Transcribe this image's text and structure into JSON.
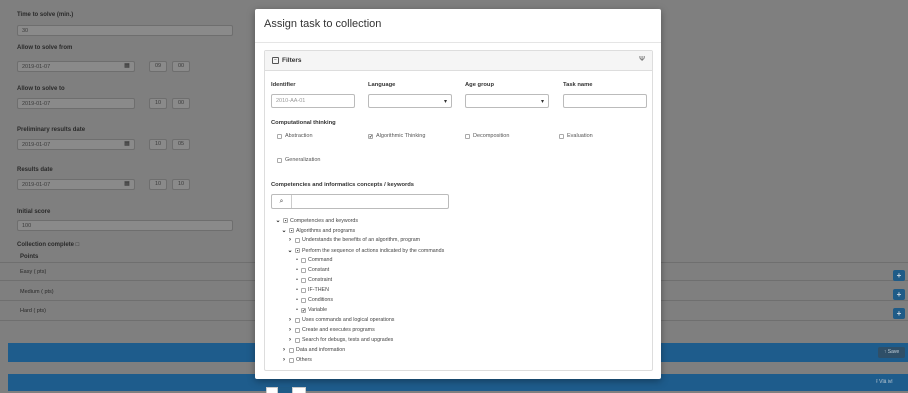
{
  "background": {
    "time_label": "Time to solve (min.)",
    "time_value": "30",
    "allow_from_label": "Allow to solve from",
    "allow_from_date": "2019-01-07",
    "allow_from_h": "09",
    "allow_from_m": "00",
    "allow_to_label": "Allow to solve to",
    "allow_to_date": "2019-01-07",
    "allow_to_h": "10",
    "allow_to_m": "00",
    "prelim_label": "Preliminary results date",
    "prelim_date": "2019-01-07",
    "prelim_h": "10",
    "prelim_m": "05",
    "results_label": "Results date",
    "results_date": "2019-01-07",
    "results_h": "10",
    "results_m": "10",
    "initial_score_label": "Initial score",
    "initial_score_value": "100",
    "collection_complete_label": "Collection complete □",
    "points_label": "Points",
    "easy_label": "Easy ( pts)",
    "medium_label": "Medium ( pts)",
    "hard_label": "Hard ( pts)",
    "plus": "+",
    "save_label": "↑ Save",
    "bottom_right_text": "⭱ Vlä ivl",
    "calendar_glyph": "▦"
  },
  "modal": {
    "title": "Assign task to collection",
    "filters_title": "Filters",
    "filter_icon_glyph": "Ψ",
    "identifier_label": "Identifier",
    "identifier_placeholder": "2010-AA-01",
    "language_label": "Language",
    "age_group_label": "Age group",
    "task_name_label": "Task name",
    "caret": "▾",
    "ct_label": "Computational thinking",
    "ct_options": [
      {
        "label": "Abstraction",
        "checked": false
      },
      {
        "label": "Algorithmic Thinking",
        "checked": true
      },
      {
        "label": "Decomposition",
        "checked": false
      },
      {
        "label": "Evaluation",
        "checked": false
      },
      {
        "label": "Generalization",
        "checked": false
      }
    ],
    "keywords_label": "Competencies and informatics concepts / keywords",
    "search_glyph": "⌕",
    "tree": [
      {
        "label": "Competencies and keywords",
        "level": 0,
        "expander": "✔",
        "checked": "partial"
      },
      {
        "label": "Algorithms and programs",
        "level": 1,
        "expander": "✔",
        "checked": "partial"
      },
      {
        "label": "Understands the benefits of an algorithm, program",
        "level": 2,
        "expander": "❯",
        "checked": "no"
      },
      {
        "label": "Perform the sequence of actions indicated by the commands",
        "level": 2,
        "expander": "✔",
        "checked": "partial"
      },
      {
        "label": "Command",
        "level": 3,
        "expander": "•",
        "checked": "no"
      },
      {
        "label": "Constant",
        "level": 3,
        "expander": "•",
        "checked": "no"
      },
      {
        "label": "Constraint",
        "level": 3,
        "expander": "•",
        "checked": "no"
      },
      {
        "label": "IF-THEN",
        "level": 3,
        "expander": "•",
        "checked": "no"
      },
      {
        "label": "Conditions",
        "level": 3,
        "expander": "•",
        "checked": "no"
      },
      {
        "label": "Variable",
        "level": 3,
        "expander": "•",
        "checked": "yes"
      },
      {
        "label": "Uses commands and logical operations",
        "level": 2,
        "expander": "❯",
        "checked": "no"
      },
      {
        "label": "Create and executes programs",
        "level": 2,
        "expander": "❯",
        "checked": "no"
      },
      {
        "label": "Search for debugs, tests and upgrades",
        "level": 2,
        "expander": "❯",
        "checked": "no"
      },
      {
        "label": "Data and information",
        "level": 1,
        "expander": "❯",
        "checked": "no"
      },
      {
        "label": "Others",
        "level": 1,
        "expander": "❯",
        "checked": "no"
      }
    ]
  }
}
